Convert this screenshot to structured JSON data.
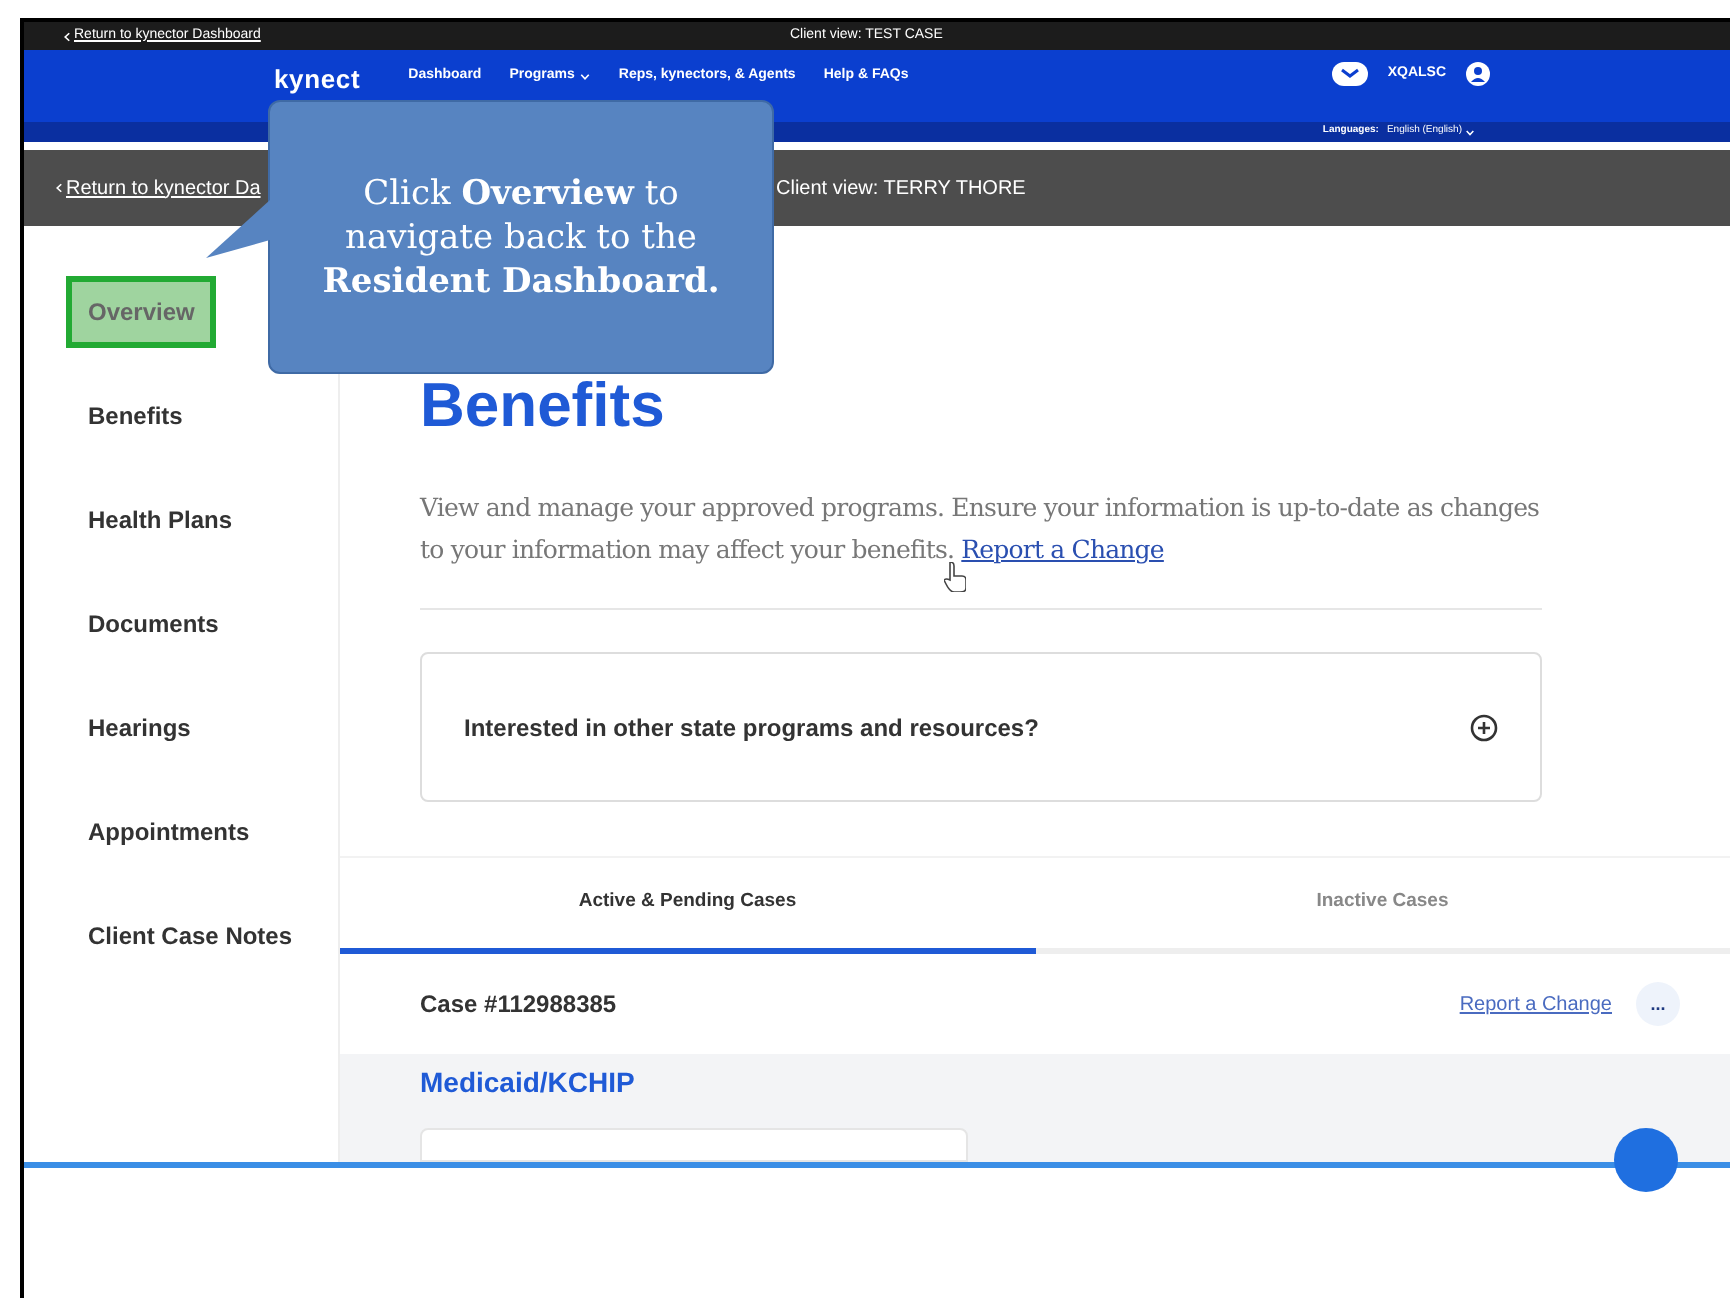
{
  "top_bar": {
    "back_link": "Return to kynector Dashboard",
    "client_view": "Client view: TEST CASE"
  },
  "nav": {
    "logo": "kynect",
    "items": [
      {
        "label": "Dashboard",
        "dropdown": false
      },
      {
        "label": "Programs",
        "dropdown": true
      },
      {
        "label": "Reps, kynectors, & Agents",
        "dropdown": false
      },
      {
        "label": "Help & FAQs",
        "dropdown": false
      }
    ],
    "user": "XQALSC",
    "language_label": "Languages:",
    "language": "English (English)"
  },
  "sub_bar": {
    "back_link": "Return to kynector Da",
    "client_view": "Client view: TERRY THORE"
  },
  "callout": "Click **Overview** to navigate back to the **Resident Dashboard.**",
  "sidebar": {
    "items": [
      {
        "label": "Overview",
        "highlighted": true
      },
      {
        "label": "Benefits",
        "highlighted": false
      },
      {
        "label": "Health Plans",
        "highlighted": false
      },
      {
        "label": "Documents",
        "highlighted": false
      },
      {
        "label": "Hearings",
        "highlighted": false
      },
      {
        "label": "Appointments",
        "highlighted": false
      },
      {
        "label": "Client Case Notes",
        "highlighted": false
      }
    ]
  },
  "page": {
    "title": "Benefits",
    "description": "View and manage your approved programs. Ensure your information is up-to-date as changes to your information may affect your benefits.",
    "link": "Report a Change",
    "accordion": "Interested in other state programs and resources?"
  },
  "tabs": [
    {
      "label": "Active & Pending Cases",
      "selected": true
    },
    {
      "label": "Inactive Cases",
      "selected": false
    }
  ],
  "case": {
    "number": "Case #112988385",
    "link": "Report a Change",
    "more": "...",
    "program": "Medicaid/KCHIP"
  }
}
